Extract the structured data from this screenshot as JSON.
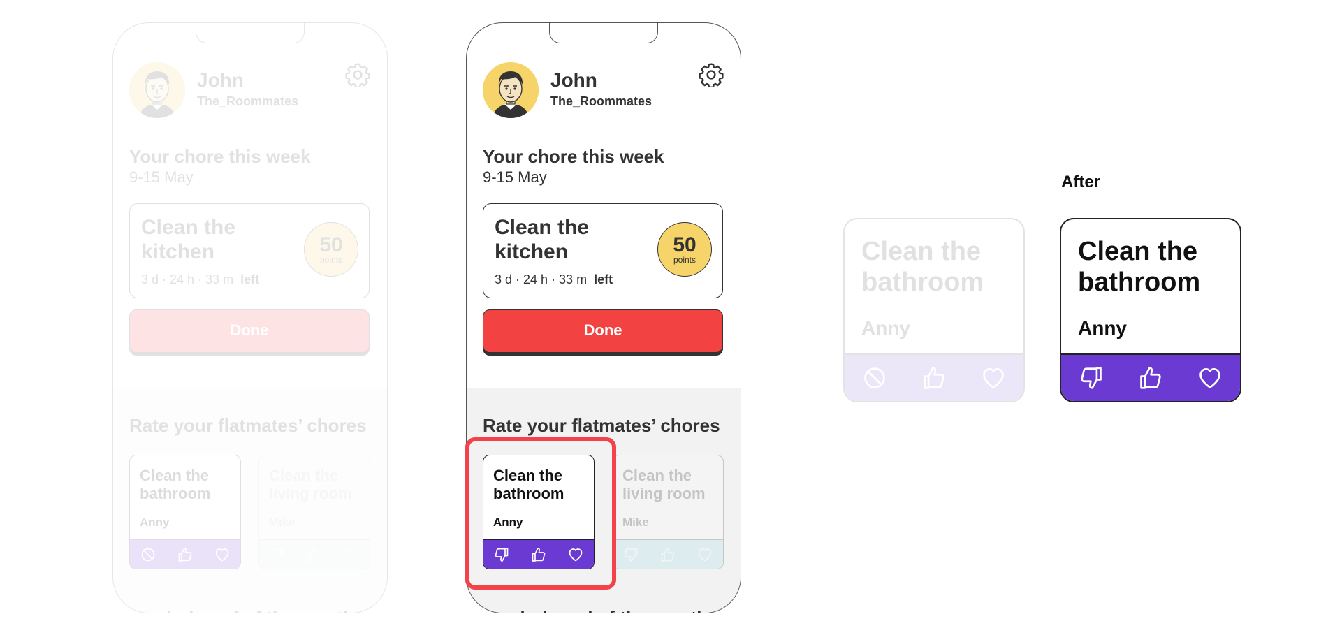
{
  "user": {
    "name": "John",
    "group": "The_Roommates"
  },
  "chore": {
    "heading": "Your chore this week",
    "dates": "9-15 May",
    "title": "Clean the kitchen",
    "time_left": "3 d · 24 h · 33 m",
    "time_suffix": "left",
    "points_value": "50",
    "points_label": "points"
  },
  "done_button": {
    "label": "Done"
  },
  "rating": {
    "heading": "Rate your flatmates’ chores",
    "cards": [
      {
        "title": "Clean the bathroom",
        "who": "Anny"
      },
      {
        "title": "Clean the living room",
        "who": "Mike"
      }
    ]
  },
  "leaderboard": {
    "heading": "Leaderboard of the month"
  },
  "after": {
    "label": "After",
    "before_card": {
      "title": "Clean the bathroom",
      "who": "Anny"
    },
    "after_card": {
      "title": "Clean the bathroom",
      "who": "Anny"
    }
  },
  "colors": {
    "accent_yellow": "#f7d46a",
    "done_red": "#f24241",
    "rating_purple": "#6a3ad3",
    "rating_cyan": "#8fd6e8",
    "highlight_red": "#f2434a"
  },
  "icons": [
    "settings-gear-icon",
    "block-icon",
    "thumbs-down-icon",
    "thumbs-up-icon",
    "heart-icon"
  ]
}
